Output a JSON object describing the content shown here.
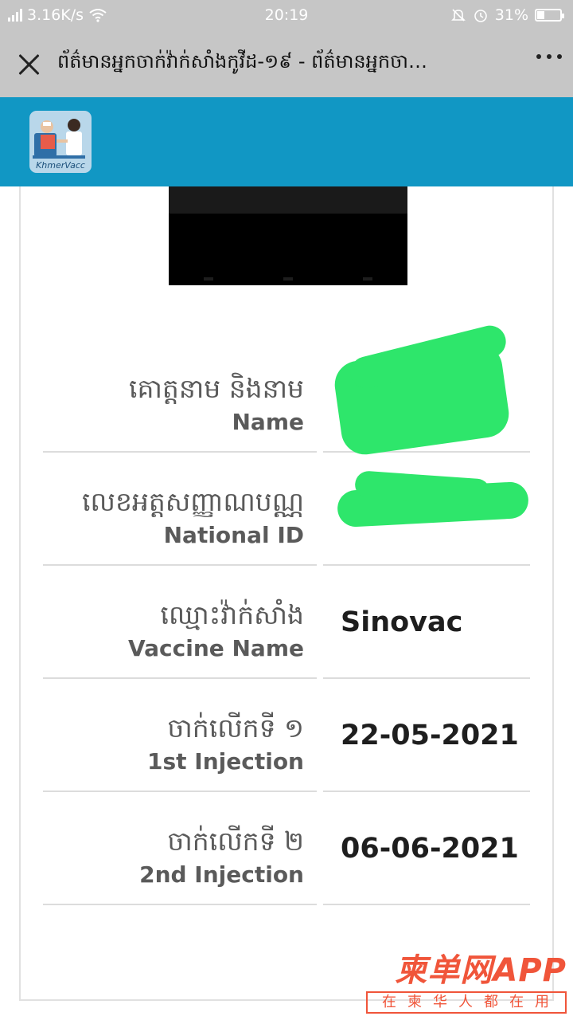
{
  "status_bar": {
    "network_type": "2G",
    "speed": "3.16K/s",
    "time": "20:19",
    "battery": "31%",
    "battery_level": 0.31
  },
  "title_bar": {
    "title": "ព័ត៌មានអ្នកចាក់វ៉ាក់សាំងកូវីដ-១៩ - ព័ត៌មានអ្នកចា…"
  },
  "app_header": {
    "logo_text": "KhmerVacc",
    "color": "#1197c4"
  },
  "info": {
    "name": {
      "label_km": "គោត្តនាម និងនាម",
      "label_en": "Name",
      "value": ""
    },
    "national_id": {
      "label_km": "លេខអត្តសញ្ញាណបណ្ណ",
      "label_en": "National ID",
      "value": ""
    },
    "vaccine_name": {
      "label_km": "ឈ្មោះវ៉ាក់សាំង",
      "label_en": "Vaccine Name",
      "value": "Sinovac"
    },
    "first_injection": {
      "label_km": "ចាក់លើកទី ១",
      "label_en": "1st Injection",
      "value": "22-05-2021"
    },
    "second_injection": {
      "label_km": "ចាក់លើកទី ២",
      "label_en": "2nd Injection",
      "value": "06-06-2021"
    }
  },
  "watermark": {
    "brand": "柬单网APP",
    "slogan": "在柬华人都在用",
    "color": "#f0553a"
  }
}
